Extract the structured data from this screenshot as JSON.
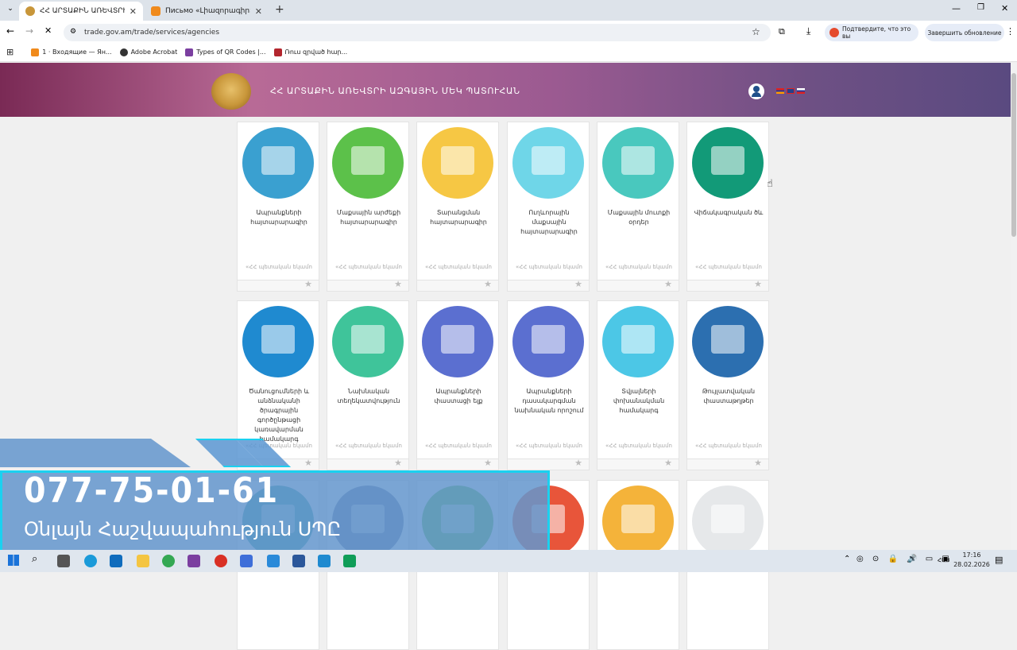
{
  "browser": {
    "tabs": [
      {
        "title": "ՀՀ ԱՐՏԱՔԻՆ ԱՌԵՎՏՐԻ ԱԶԳ",
        "active": true
      },
      {
        "title": "Письмо «Լիազորագիր» — А",
        "active": false
      }
    ],
    "url": "trade.gov.am/trade/services/agencies",
    "bookmarks": [
      "1 · Входящие — Ян...",
      "Adobe Acrobat",
      "Types of QR Codes |...",
      "Ռուս զրված հար..."
    ],
    "translate_button": "Подтвердите, что это вы",
    "update_button": "Завершить обновление"
  },
  "site": {
    "title": "ՀՀ ԱՐՏԱՔԻՆ ԱՌԵՎՏՐԻ ԱԶԳԱՅԻՆ ՄԵԿ ՊԱՏՈՒՀԱՆ",
    "source_label": "«ՀՀ պետական եկամո",
    "cards": [
      {
        "label": "Ապրանքների հայտարարագիր",
        "icon": "laptop-form-icon",
        "color": "#3aa0d0"
      },
      {
        "label": "Մաքսային արժեքի հայտարարագիր",
        "icon": "search-document-icon",
        "color": "#5cc14a"
      },
      {
        "label": "Տարանցման հայտարարագիր",
        "icon": "road-pin-icon",
        "color": "#f6c744"
      },
      {
        "label": "Ուղևորային մաքսային հայտարարագիր",
        "icon": "suitcase-icon",
        "color": "#6fd6e8"
      },
      {
        "label": "Մաքսային մուտքի օրդեր",
        "icon": "laptop-document-icon",
        "color": "#49c8be"
      },
      {
        "label": "Վիճակագրական ծև",
        "icon": "calendar-icon",
        "color": "#129a78"
      },
      {
        "label": "Ծանուցումների և անձնականի ծրագրային գործընթացի կառավարման համակարգ",
        "icon": "gear-bell-icon",
        "color": "#1f8ad0"
      },
      {
        "label": "Նախնական տեղեկատվություն",
        "icon": "clock-truck-icon",
        "color": "#3fc49a"
      },
      {
        "label": "Ապրանքների փաստացի ելք",
        "icon": "qr-exit-icon",
        "color": "#5b6fd0"
      },
      {
        "label": "Ապրանքների դասակարգման նախնական որոշում",
        "icon": "checklist-icon",
        "color": "#5b6fd0"
      },
      {
        "label": "Տվյալների փոխանակման համակարգ",
        "icon": "info-refresh-icon",
        "color": "#4cc7e6"
      },
      {
        "label": "Թույլատվական փաստաթղթեր",
        "icon": "documents-stamp-icon",
        "color": "#2c6fb0"
      },
      {
        "label": "",
        "icon": "map-icon",
        "color": "#3aa0a0"
      },
      {
        "label": "",
        "icon": "fast-truck-icon",
        "color": "#6c7aa0"
      },
      {
        "label": "",
        "icon": "box-hand-icon",
        "color": "#5cc14a"
      },
      {
        "label": "",
        "icon": "red-truck-icon",
        "color": "#e8553a"
      },
      {
        "label": "",
        "icon": "report-chart-icon",
        "color": "#f4b33a"
      },
      {
        "label": "",
        "icon": "binders-icon",
        "color": "#e6e8ea"
      }
    ]
  },
  "overlay": {
    "phone": "077-75-01-61",
    "company": "Օնլայն Հաշվապահություն ՍՊԸ"
  },
  "taskbar": {
    "lang": "ՀԱՅ",
    "time": "17:16",
    "date": "28.02.2026"
  }
}
